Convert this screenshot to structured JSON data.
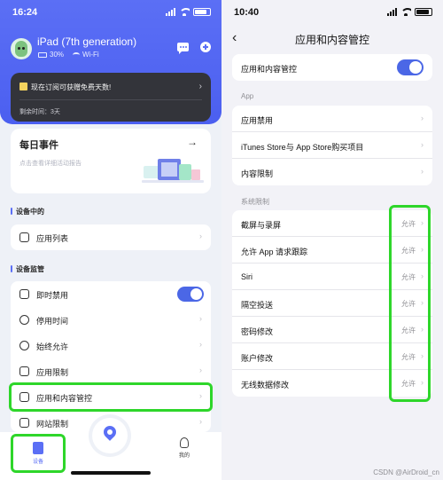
{
  "left": {
    "status_bar": {
      "time": "16:24"
    },
    "device": {
      "name": "iPad (7th generation)",
      "battery": "30%",
      "network": "Wi-Fi"
    },
    "promo": {
      "text": "现在订阅可获赠免费天数!",
      "remaining": "剩余时间：3天"
    },
    "daily": {
      "title": "每日事件",
      "subtitle": "点击查看详细活动报告"
    },
    "sections": {
      "in_device": "设备中的",
      "monitor": "设备监管"
    },
    "app_list": {
      "label": "应用列表"
    },
    "monitor_items": [
      {
        "label": "即时禁用",
        "toggle": true
      },
      {
        "label": "停用时间"
      },
      {
        "label": "始终允许"
      },
      {
        "label": "应用限制"
      },
      {
        "label": "应用和内容管控",
        "highlighted": true
      },
      {
        "label": "网站限制"
      }
    ],
    "tabs": {
      "device": "设备",
      "mine": "我的"
    },
    "colors": {
      "brand": "#5b6ff5",
      "highlight": "#2ed62a"
    }
  },
  "right": {
    "status_bar": {
      "time": "10:40"
    },
    "nav": {
      "title": "应用和内容管控"
    },
    "master_toggle": {
      "label": "应用和内容管控",
      "on": true
    },
    "app_section": {
      "header": "App",
      "items": [
        {
          "label": "应用禁用"
        },
        {
          "label": "iTunes Store与 App Store购买项目"
        },
        {
          "label": "内容限制"
        }
      ]
    },
    "system_section": {
      "header": "系统限制",
      "items": [
        {
          "label": "截屏与录屏",
          "value": "允许"
        },
        {
          "label": "允许 App 请求跟踪",
          "value": "允许"
        },
        {
          "label": "Siri",
          "value": "允许"
        },
        {
          "label": "隔空投送",
          "value": "允许"
        },
        {
          "label": "密码修改",
          "value": "允许"
        },
        {
          "label": "账户修改",
          "value": "允许"
        },
        {
          "label": "无线数据修改",
          "value": "允许"
        }
      ]
    },
    "watermark": "CSDN @AirDroid_cn"
  }
}
